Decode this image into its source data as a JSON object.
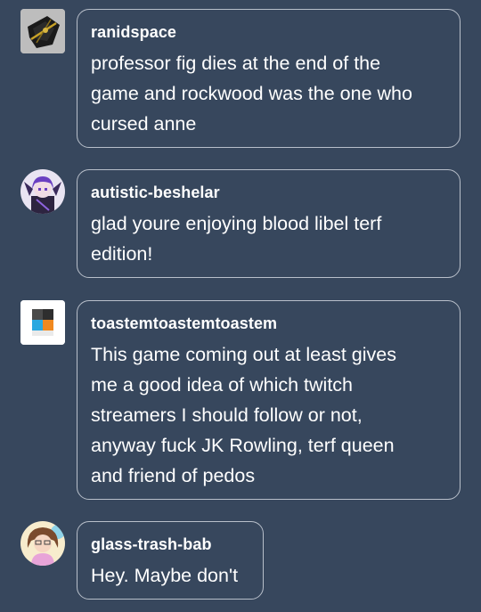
{
  "replies": [
    {
      "username": "ranidspace",
      "avatar_icon": "dark-sketch-avatar-icon",
      "message": "professor fig dies at the end of the\ngame and rockwood was the one who\ncursed anne"
    },
    {
      "username": "autistic-beshelar",
      "avatar_icon": "purple-character-avatar-icon",
      "message": "glad youre enjoying blood libel terf\nedition!"
    },
    {
      "username": "toastemtoastemtoastem",
      "avatar_icon": "color-squares-avatar-icon",
      "message": "This game coming out at least gives\nme a good idea of which twitch\nstreamers I should follow or not,\nanyway fuck JK Rowling, terf queen\nand friend of pedos"
    },
    {
      "username": "glass-trash-bab",
      "avatar_icon": "cartoon-girl-avatar-icon",
      "message": "Hey. Maybe don't"
    }
  ],
  "colors": {
    "background": "#37475d",
    "bubble_border": "#b8bfca",
    "text": "#ffffff"
  }
}
